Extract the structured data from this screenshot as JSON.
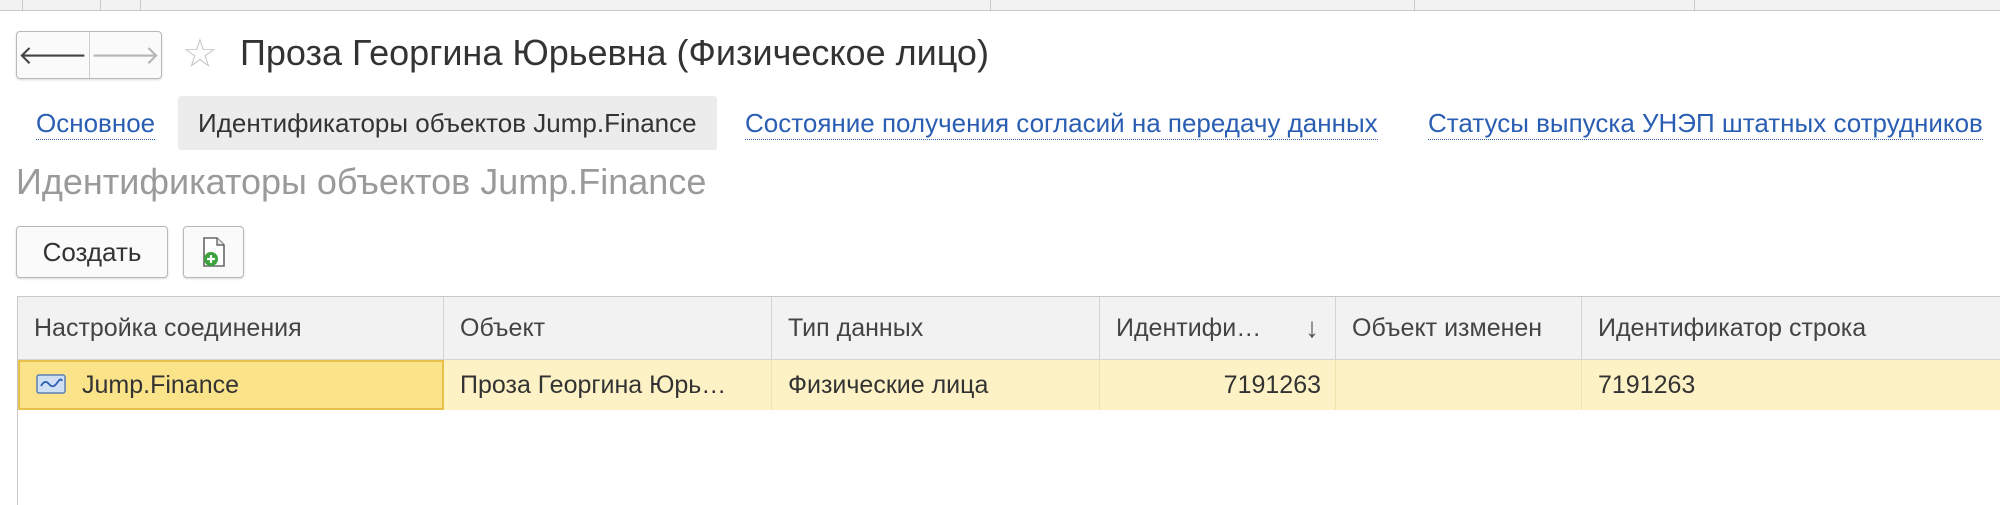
{
  "header": {
    "title": "Проза Георгина Юрьевна (Физическое лицо)",
    "back_icon": "arrow-left-icon",
    "forward_icon": "arrow-right-icon",
    "favorite_icon": "star-icon"
  },
  "tabs": [
    {
      "label": "Основное",
      "active": false
    },
    {
      "label": "Идентификаторы объектов Jump.Finance",
      "active": true
    },
    {
      "label": "Состояние получения согласий на передачу данных",
      "active": false
    },
    {
      "label": "Статусы выпуска УНЭП штатных сотрудников",
      "active": false
    }
  ],
  "section": {
    "title": "Идентификаторы объектов Jump.Finance"
  },
  "toolbar": {
    "create_label": "Создать",
    "add_doc_icon": "document-add-icon"
  },
  "table": {
    "columns": [
      "Настройка соединения",
      "Объект",
      "Тип данных",
      "Идентифи…",
      "Объект изменен",
      "Идентификатор строка"
    ],
    "sort_indicator": "↓",
    "rows": [
      {
        "connection": "Jump.Finance",
        "object": "Проза Георгина Юрь…",
        "data_type": "Физические лица",
        "identifier": "7191263",
        "object_changed": "",
        "identifier_string": "7191263"
      }
    ]
  },
  "colors": {
    "link": "#2a5eb3",
    "selected_row": "#fdf2c5",
    "selected_cell": "#fbe38a"
  }
}
